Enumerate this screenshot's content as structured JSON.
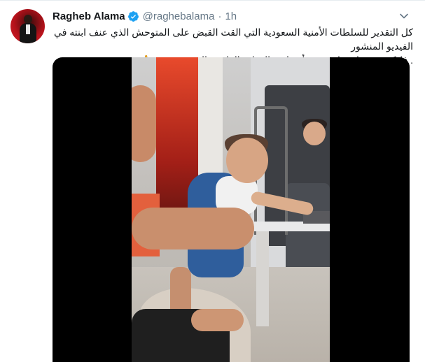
{
  "tweet": {
    "author_name": "Ragheb Alama",
    "verified_icon": "verified-badge-icon",
    "handle": "@raghebalama",
    "separator": "·",
    "time": "1h",
    "text_line_1": "كل التقدير للسلطات الأمنية السعودية التي القت القبض على المتوحش الذي عنف ابنته في الفيديو المنشور",
    "text_line_2": ". فليكن عبرة لمن اعتبر .. وأن يلقى العقاب القاسي الذي يستحقه 🙏"
  },
  "icons": {
    "caret": "chevron-down-icon",
    "avatar": "profile-avatar"
  },
  "colors": {
    "name_text": "#14171a",
    "secondary_text": "#657786",
    "verified_blue": "#1da1f2",
    "media_background": "#000000"
  }
}
